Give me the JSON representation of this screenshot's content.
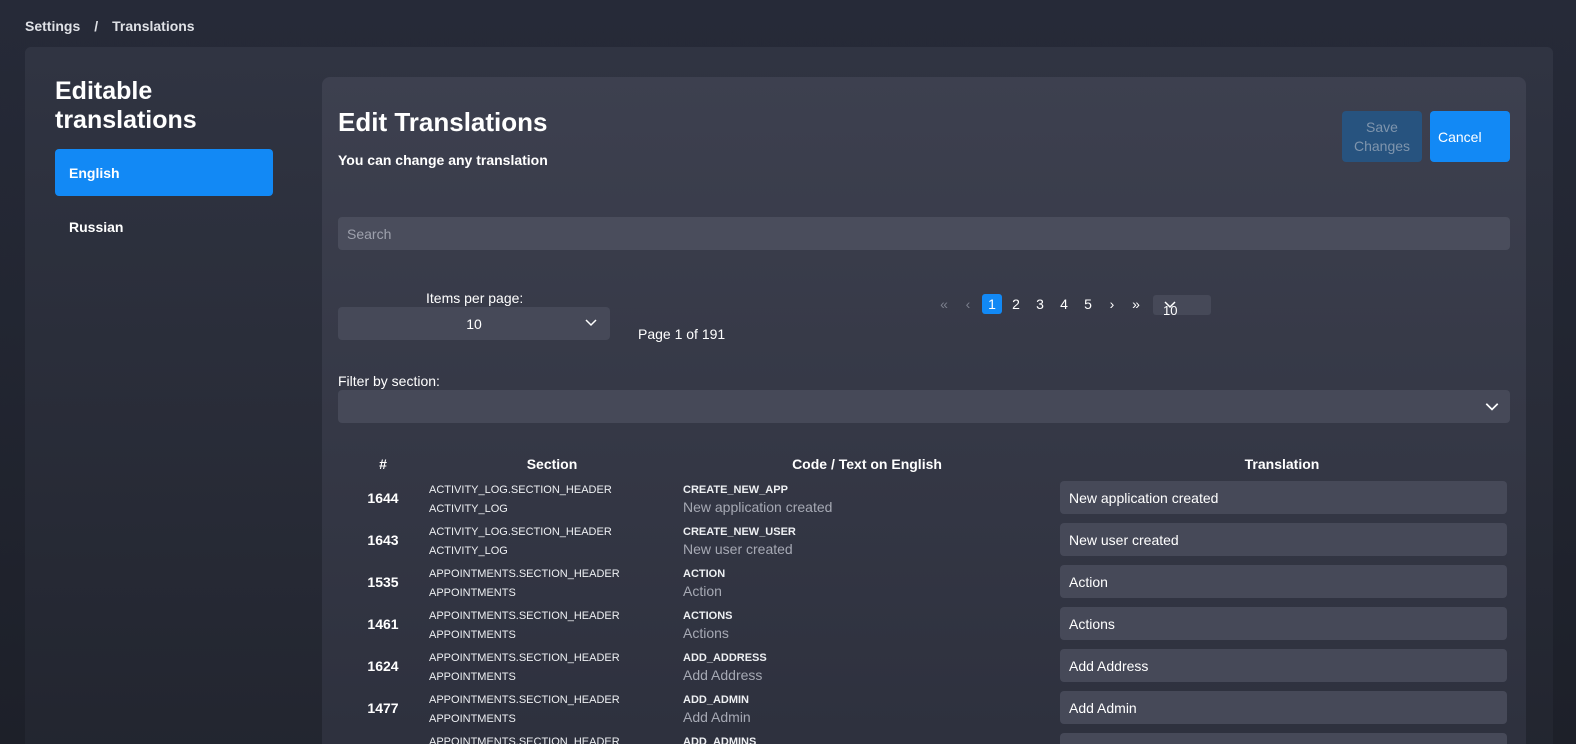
{
  "breadcrumb": {
    "root": "Settings",
    "separator": "/",
    "current": "Translations"
  },
  "sidebar": {
    "title": "Editable translations",
    "languages": [
      {
        "label": "English",
        "active": true
      },
      {
        "label": "Russian",
        "active": false
      }
    ]
  },
  "panel": {
    "title": "Edit Translations",
    "subtitle": "You can change any translation",
    "save_label": "Save Changes",
    "cancel_label": "Cancel",
    "search_placeholder": "Search",
    "items_per_page_label": "Items per page:",
    "items_per_page_value": "10",
    "page_info": "Page 1 of 191",
    "pager": {
      "first": "«",
      "prev": "‹",
      "pages": [
        "1",
        "2",
        "3",
        "4",
        "5"
      ],
      "current": "1",
      "next": "›",
      "last": "»",
      "size_value": "10"
    },
    "filter_label": "Filter by section:",
    "filter_value": ""
  },
  "table": {
    "headers": {
      "num": "#",
      "section": "Section",
      "code": "Code / Text on English",
      "translation": "Translation"
    },
    "rows": [
      {
        "num": "1644",
        "section_header": "ACTIVITY_LOG.SECTION_HEADER",
        "section": "ACTIVITY_LOG",
        "code": "CREATE_NEW_APP",
        "text": "New application created",
        "translation": "New application created"
      },
      {
        "num": "1643",
        "section_header": "ACTIVITY_LOG.SECTION_HEADER",
        "section": "ACTIVITY_LOG",
        "code": "CREATE_NEW_USER",
        "text": "New user created",
        "translation": "New user created"
      },
      {
        "num": "1535",
        "section_header": "APPOINTMENTS.SECTION_HEADER",
        "section": "APPOINTMENTS",
        "code": "ACTION",
        "text": "Action",
        "translation": "Action"
      },
      {
        "num": "1461",
        "section_header": "APPOINTMENTS.SECTION_HEADER",
        "section": "APPOINTMENTS",
        "code": "ACTIONS",
        "text": "Actions",
        "translation": "Actions"
      },
      {
        "num": "1624",
        "section_header": "APPOINTMENTS.SECTION_HEADER",
        "section": "APPOINTMENTS",
        "code": "ADD_ADDRESS",
        "text": "Add Address",
        "translation": "Add Address"
      },
      {
        "num": "1477",
        "section_header": "APPOINTMENTS.SECTION_HEADER",
        "section": "APPOINTMENTS",
        "code": "ADD_ADMIN",
        "text": "Add Admin",
        "translation": "Add Admin"
      },
      {
        "num": "",
        "section_header": "APPOINTMENTS.SECTION_HEADER",
        "section": "",
        "code": "ADD_ADMINS",
        "text": "",
        "translation": ""
      }
    ]
  }
}
